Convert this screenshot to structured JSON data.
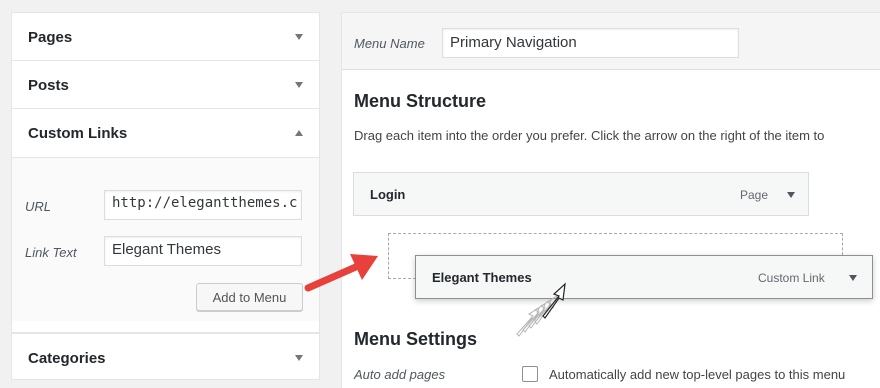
{
  "sidebar": {
    "sections": [
      {
        "title": "Pages",
        "state": "collapsed"
      },
      {
        "title": "Posts",
        "state": "collapsed"
      },
      {
        "title": "Custom Links",
        "state": "expanded"
      },
      {
        "title": "Categories",
        "state": "collapsed"
      }
    ],
    "custom_links": {
      "url_label": "URL",
      "url_value": "http://elegantthemes.c",
      "link_text_label": "Link Text",
      "link_text_value": "Elegant Themes",
      "add_button": "Add to Menu"
    }
  },
  "menu_editor": {
    "menu_name_label": "Menu Name",
    "menu_name_value": "Primary Navigation",
    "structure_title": "Menu Structure",
    "instructions": "Drag each item into the order you prefer. Click the arrow on the right of the item to",
    "items": [
      {
        "title": "Login",
        "type": "Page"
      },
      {
        "title": "Elegant Themes",
        "type": "Custom Link"
      }
    ],
    "settings_title": "Menu Settings",
    "auto_add_label": "Auto add pages",
    "auto_add_checkbox_label": "Automatically add new top-level pages to this menu"
  },
  "colors": {
    "annotation_arrow": "#e8413c"
  },
  "icons": [
    "caret-down-icon",
    "caret-up-icon",
    "drag-cursor-icon",
    "annotation-arrow-icon"
  ]
}
